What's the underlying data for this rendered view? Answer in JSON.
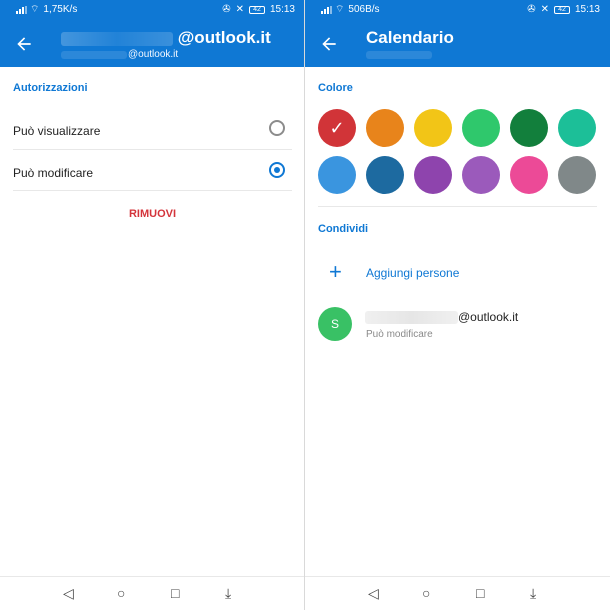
{
  "left_screen": {
    "status_bar": {
      "network_speed": "1,75K/s",
      "time": "15:13",
      "battery": "42"
    },
    "header": {
      "title_suffix": "@outlook.it",
      "subtitle_suffix": "@outlook.it",
      "background_color": "#0f78d4"
    },
    "permissions": {
      "section_label": "Autorizzazioni",
      "options": [
        {
          "label": "Può visualizzare",
          "selected": false
        },
        {
          "label": "Può modificare",
          "selected": true
        }
      ]
    },
    "actions": {
      "remove_label": "RIMUOVI"
    }
  },
  "right_screen": {
    "status_bar": {
      "network_speed": "506B/s",
      "time": "15:13",
      "battery": "42"
    },
    "header": {
      "title": "Calendario"
    },
    "color_section": {
      "label": "Colore",
      "swatches": [
        {
          "color": "#d13438",
          "selected": true
        },
        {
          "color": "#e8841b",
          "selected": false
        },
        {
          "color": "#f2c517",
          "selected": false
        },
        {
          "color": "#2fc86c",
          "selected": false
        },
        {
          "color": "#127f3c",
          "selected": false
        },
        {
          "color": "#1cbf98",
          "selected": false
        },
        {
          "color": "#3a95df",
          "selected": false
        },
        {
          "color": "#1d6aa0",
          "selected": false
        },
        {
          "color": "#8e44ad",
          "selected": false
        },
        {
          "color": "#9b5abb",
          "selected": false
        },
        {
          "color": "#ec4a97",
          "selected": false
        },
        {
          "color": "#808889",
          "selected": false
        }
      ]
    },
    "share_section": {
      "label": "Condividi",
      "add_people_label": "Aggiungi persone",
      "shared_user": {
        "avatar_initial": "S",
        "email_suffix": "@outlook.it",
        "permission": "Può modificare",
        "avatar_color": "#39c165"
      }
    }
  },
  "nav_bar": {
    "icons": [
      "back-triangle-icon",
      "home-circle-icon",
      "recent-square-icon",
      "notification-pull-icon"
    ]
  }
}
